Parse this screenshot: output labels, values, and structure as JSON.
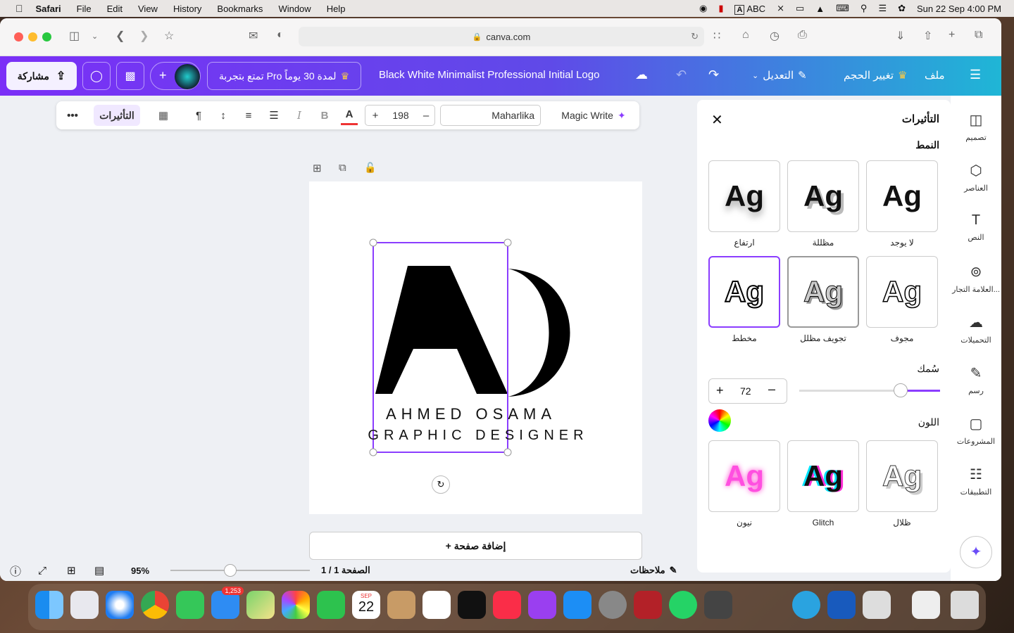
{
  "menubar": {
    "app": "Safari",
    "items": [
      "File",
      "Edit",
      "View",
      "History",
      "Bookmarks",
      "Window",
      "Help"
    ],
    "abc": "ABC",
    "clock": "Sun 22 Sep  4:00 PM"
  },
  "safari": {
    "url": "canva.com"
  },
  "canva": {
    "share": "مشاركة",
    "pro": "تمتع بتجربة Pro لمدة 30 يوماً",
    "title": "Black White Minimalist Professional Initial Logo",
    "edit": "التعديل",
    "resize": "تغيير الحجم",
    "file": "ملف"
  },
  "toolbar": {
    "effects": "التأثيرات",
    "size": "198",
    "font": "Maharlika",
    "magic": "Magic Write"
  },
  "logo": {
    "line1": "AHMED OSAMA",
    "line2": "GRAPHIC DESIGNER"
  },
  "addpage": "+ إضافة صفحة",
  "bottom": {
    "zoom": "95%",
    "pages": "الصفحة 1 / 1",
    "notes": "ملاحظات"
  },
  "panel": {
    "title": "التأثيرات",
    "style": "النمط",
    "thickness": "سُمك",
    "thickness_value": "72",
    "thickness_fraction": 0.72,
    "color": "اللون",
    "effects": [
      {
        "label": "ارتفاع"
      },
      {
        "label": "مظللة"
      },
      {
        "label": "لا يوجد"
      },
      {
        "label": "مخطط"
      },
      {
        "label": "تجويف مظلل"
      },
      {
        "label": "مجوف"
      },
      {
        "label": "نيون"
      },
      {
        "label": "Glitch"
      },
      {
        "label": "ظلال"
      }
    ],
    "sample": "Ag"
  },
  "rail": [
    {
      "label": "تصميم",
      "icon": "layout-icon"
    },
    {
      "label": "العناصر",
      "icon": "elements-icon"
    },
    {
      "label": "النص",
      "icon": "text-icon"
    },
    {
      "label": "العلامة التجار...",
      "icon": "brand-icon"
    },
    {
      "label": "التحميلات",
      "icon": "upload-icon"
    },
    {
      "label": "رسم",
      "icon": "draw-icon"
    },
    {
      "label": "المشروعات",
      "icon": "folder-icon"
    },
    {
      "label": "التطبيقات",
      "icon": "apps-icon"
    }
  ],
  "dock": {
    "mail_badge": "1,253",
    "calendar_month": "SEP",
    "calendar_day": "22"
  }
}
